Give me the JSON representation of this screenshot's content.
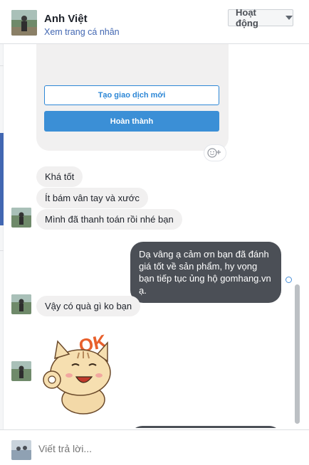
{
  "header": {
    "name": "Anh Việt",
    "profile_link": "Xem trang cá nhân",
    "status": "Hoạt động"
  },
  "card": {
    "new_transaction": "Tạo giao dịch mới",
    "done": "Hoàn thành"
  },
  "messages": [
    {
      "from": "them",
      "text": "Khá tốt"
    },
    {
      "from": "them",
      "text": "Ít bám vân tay và xước"
    },
    {
      "from": "them",
      "text": "Mình đã thanh toán rồi nhé bạn"
    },
    {
      "from": "me",
      "text": "Dạ vâng ạ cảm ơn bạn đã đánh giá tốt về sản phẩm, hy vọng bạn tiếp tục ủng hộ gomhang.vn ạ."
    },
    {
      "from": "them",
      "text": "Vậy có quà gì ko bạn"
    }
  ],
  "sticker": {
    "text": "OK",
    "icon": "cat-ok-sticker"
  },
  "composer": {
    "placeholder": "Viết trả lời..."
  },
  "colors": {
    "accent": "#4267b2",
    "outgoing": "#4b4f56",
    "incoming": "#f1f0f0",
    "button": "#3b8fd6"
  }
}
